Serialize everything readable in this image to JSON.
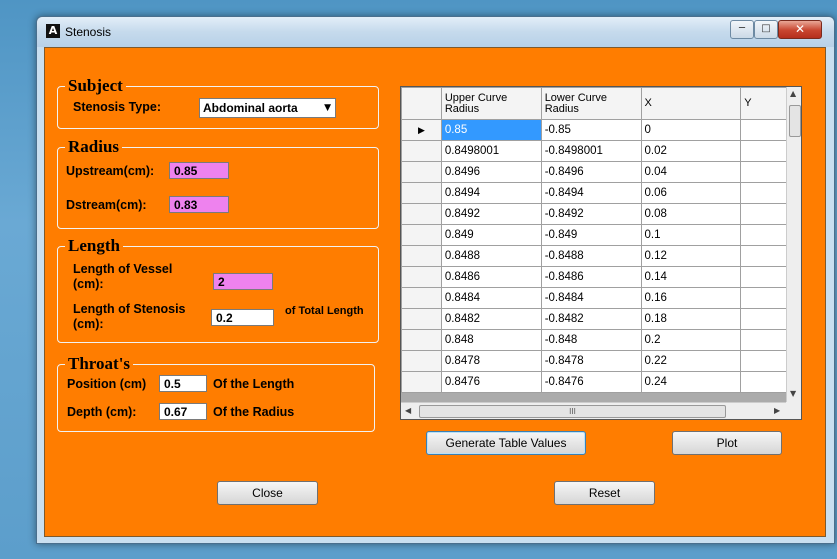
{
  "window": {
    "title": "Stenosis",
    "icon": "app-icon",
    "icon_glyph": "A"
  },
  "subject": {
    "group_title": "Subject",
    "stenosis_type_label": "Stenosis Type:",
    "stenosis_type_value": "Abdominal aorta"
  },
  "radius": {
    "group_title": "Radius",
    "upstream_label": "Upstream(cm):",
    "upstream_value": "0.85",
    "dstream_label": "Dstream(cm):",
    "dstream_value": "0.83"
  },
  "length": {
    "group_title": "Length",
    "vessel_label_1": "Length of Vessel",
    "vessel_label_2": "(cm):",
    "vessel_value": "2",
    "stenosis_label_1": "Length of Stenosis",
    "stenosis_label_2": "(cm):",
    "stenosis_value": "0.2",
    "stenosis_suffix": "of Total Length"
  },
  "throat": {
    "group_title": "Throat's",
    "position_label": "Position (cm)",
    "position_value": "0.5",
    "position_suffix": "Of the Length",
    "depth_label": "Depth (cm):",
    "depth_value": "0.67",
    "depth_suffix": "Of the Radius"
  },
  "table": {
    "columns": [
      "Upper Curve Radius",
      "Lower Curve Radius",
      "X",
      "Y"
    ],
    "column_lines": [
      [
        "Upper Curve",
        "Radius"
      ],
      [
        "Lower Curve",
        "Radius"
      ],
      [
        "X"
      ],
      [
        "Y"
      ]
    ],
    "current_row_marker": "▶",
    "rows": [
      [
        "0.85",
        "-0.85",
        "0",
        ""
      ],
      [
        "0.8498001",
        "-0.8498001",
        "0.02",
        ""
      ],
      [
        "0.8496",
        "-0.8496",
        "0.04",
        ""
      ],
      [
        "0.8494",
        "-0.8494",
        "0.06",
        ""
      ],
      [
        "0.8492",
        "-0.8492",
        "0.08",
        ""
      ],
      [
        "0.849",
        "-0.849",
        "0.1",
        ""
      ],
      [
        "0.8488",
        "-0.8488",
        "0.12",
        ""
      ],
      [
        "0.8486",
        "-0.8486",
        "0.14",
        ""
      ],
      [
        "0.8484",
        "-0.8484",
        "0.16",
        ""
      ],
      [
        "0.8482",
        "-0.8482",
        "0.18",
        ""
      ],
      [
        "0.848",
        "-0.848",
        "0.2",
        ""
      ],
      [
        "0.8478",
        "-0.8478",
        "0.22",
        ""
      ],
      [
        "0.8476",
        "-0.8476",
        "0.24",
        ""
      ]
    ],
    "hscroll_grip": "III"
  },
  "buttons": {
    "generate": "Generate Table Values",
    "plot": "Plot",
    "close": "Close",
    "reset": "Reset"
  },
  "colors": {
    "form_background": "#ff7d00",
    "highlight_field": "#ee82ee",
    "selection": "#3399ff"
  }
}
